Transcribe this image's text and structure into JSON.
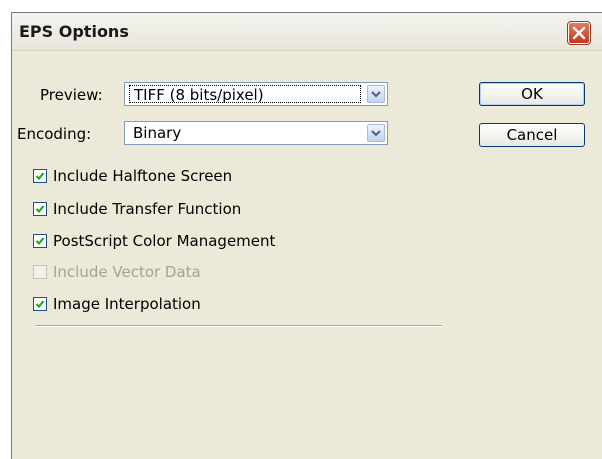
{
  "window": {
    "title": "EPS Options"
  },
  "preview": {
    "label": "Preview:",
    "value": "TIFF  (8 bits/pixel)"
  },
  "encoding": {
    "label": "Encoding:",
    "value": "Binary"
  },
  "buttons": {
    "ok": "OK",
    "cancel": "Cancel"
  },
  "options": [
    {
      "label": "Include Halftone Screen",
      "checked": true,
      "enabled": true
    },
    {
      "label": "Include Transfer Function",
      "checked": true,
      "enabled": true
    },
    {
      "label": "PostScript Color Management",
      "checked": true,
      "enabled": true
    },
    {
      "label": "Include Vector Data",
      "checked": false,
      "enabled": false
    },
    {
      "label": "Image Interpolation",
      "checked": true,
      "enabled": true
    }
  ],
  "icons": {
    "close": "close-icon",
    "dropdown": "chevron-down-icon",
    "check": "check-icon"
  },
  "colors": {
    "window_bg": "#ece9d8",
    "close_button": "#c2371b",
    "button_border": "#003c74",
    "check_mark": "#21a121"
  }
}
